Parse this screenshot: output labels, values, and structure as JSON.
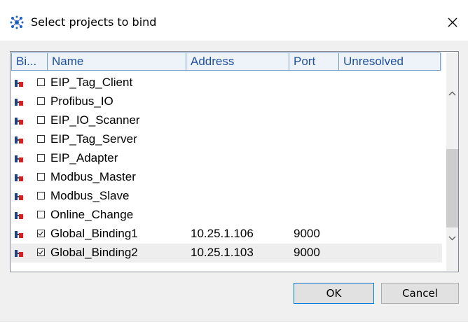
{
  "window": {
    "title": "Select projects to bind"
  },
  "list": {
    "columns": [
      "Bi...",
      "Name",
      "Address",
      "Port",
      "Unresolved"
    ],
    "rows": [
      {
        "name": "EIP_Tag_Client",
        "address": "",
        "port": "",
        "unresolved": "",
        "checked": false
      },
      {
        "name": "Profibus_IO",
        "address": "",
        "port": "",
        "unresolved": "",
        "checked": false
      },
      {
        "name": "EIP_IO_Scanner",
        "address": "",
        "port": "",
        "unresolved": "",
        "checked": false
      },
      {
        "name": "EIP_Tag_Server",
        "address": "",
        "port": "",
        "unresolved": "",
        "checked": false
      },
      {
        "name": "EIP_Adapter",
        "address": "",
        "port": "",
        "unresolved": "",
        "checked": false
      },
      {
        "name": "Modbus_Master",
        "address": "",
        "port": "",
        "unresolved": "",
        "checked": false
      },
      {
        "name": "Modbus_Slave",
        "address": "",
        "port": "",
        "unresolved": "",
        "checked": false
      },
      {
        "name": "Online_Change",
        "address": "",
        "port": "",
        "unresolved": "",
        "checked": false
      },
      {
        "name": "Global_Binding1",
        "address": "10.25.1.106",
        "port": "9000",
        "unresolved": "",
        "checked": true
      },
      {
        "name": "Global_Binding2",
        "address": "10.25.1.103",
        "port": "9000",
        "unresolved": "",
        "checked": true
      }
    ]
  },
  "buttons": {
    "ok": "OK",
    "cancel": "Cancel"
  },
  "icons": {
    "title": "network-binding-icon",
    "project": "project-binding-icon"
  },
  "colors": {
    "header_text": "#1f50a0",
    "header_bg": "#eef3fa",
    "ok_border": "#0078d7"
  }
}
